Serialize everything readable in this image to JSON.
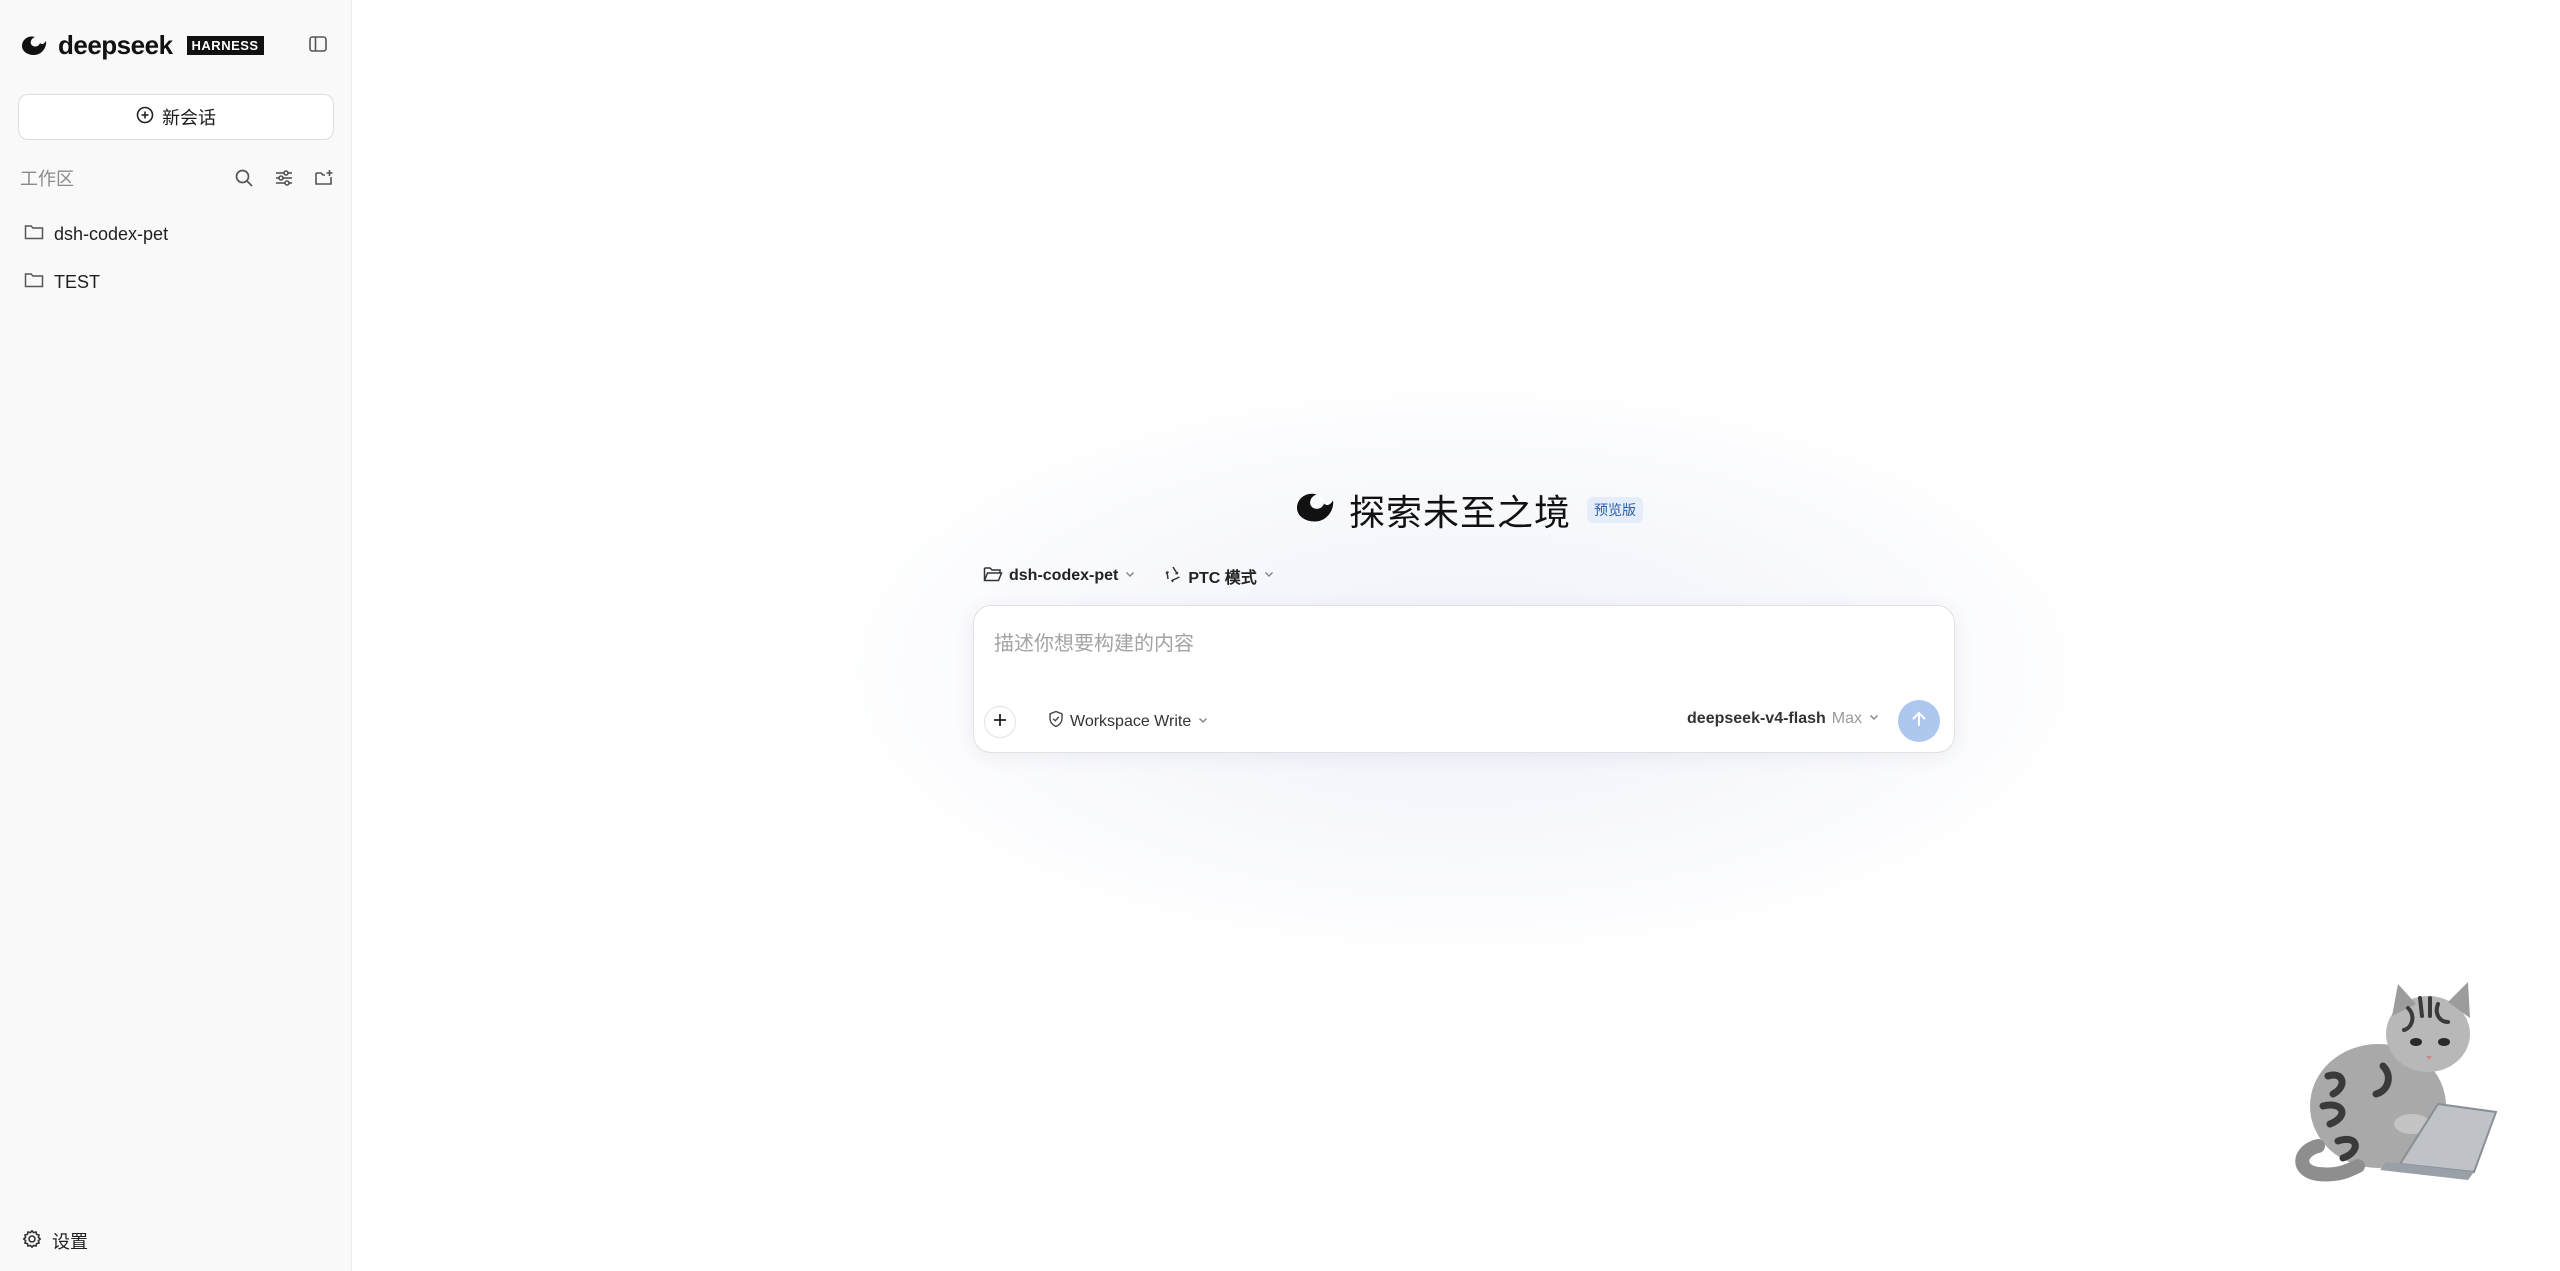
{
  "sidebar": {
    "brand_name": "deepseek",
    "brand_badge": "HARNESS",
    "new_chat_label": "新会话",
    "workspace_title": "工作区",
    "workspaces": [
      {
        "label": "dsh-codex-pet",
        "icon": "folder-icon"
      },
      {
        "label": "TEST",
        "icon": "folder-icon"
      }
    ],
    "settings_label": "设置"
  },
  "main": {
    "hero_title": "探索未至之境",
    "hero_badge": "预览版",
    "project_selector": "dsh-codex-pet",
    "mode_selector": "PTC 模式",
    "composer": {
      "placeholder": "描述你想要构建的内容",
      "permission_label": "Workspace Write",
      "model_name": "deepseek-v4-flash",
      "model_level": "Max"
    }
  },
  "colors": {
    "sidebar_bg": "#f9f9f9",
    "send_button": "#aec7ef",
    "badge_bg": "#e4edf9",
    "badge_text": "#2b5fa8"
  }
}
